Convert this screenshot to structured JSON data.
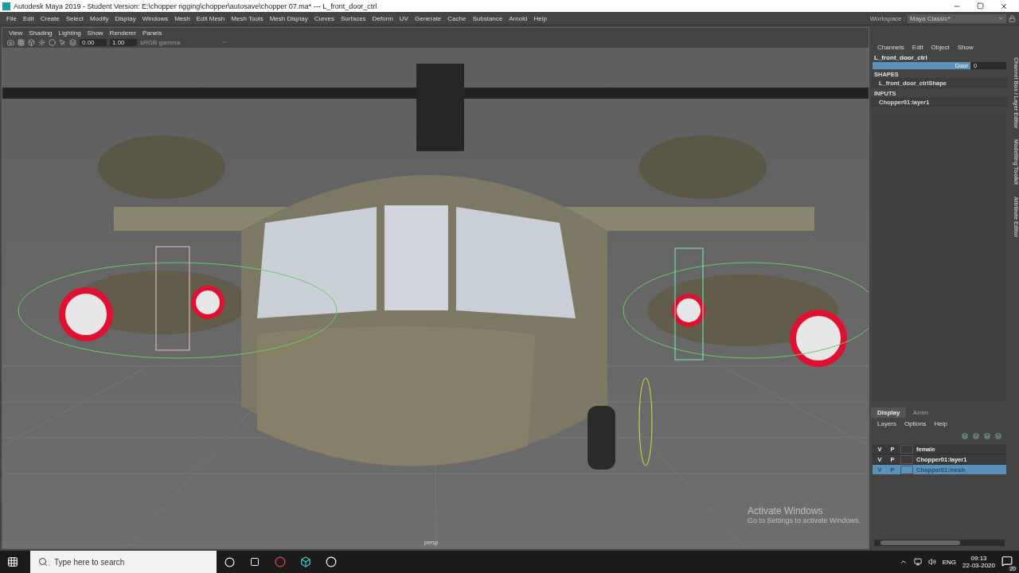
{
  "window": {
    "title": "Autodesk Maya 2019 - Student Version: E:\\chopper rigging\\chopper\\autosave\\chopper 07.ma*   ---   L_front_door_ctrl"
  },
  "menu": [
    "File",
    "Edit",
    "Create",
    "Select",
    "Modify",
    "Display",
    "Windows",
    "Mesh",
    "Edit Mesh",
    "Mesh Tools",
    "Mesh Display",
    "Curves",
    "Surfaces",
    "Deform",
    "UV",
    "Generate",
    "Cache",
    "Substance",
    "Arnold",
    "Help"
  ],
  "workspace": {
    "label": "Workspace :",
    "value": "Maya Classic*"
  },
  "viewport": {
    "menu": [
      "View",
      "Shading",
      "Lighting",
      "Show",
      "Renderer",
      "Panels"
    ],
    "exposure": "0.00",
    "gamma": "1.00",
    "color_space": "sRGB gamma",
    "camera": "persp"
  },
  "channel_box": {
    "menu": [
      "Channels",
      "Edit",
      "Object",
      "Show"
    ],
    "node": "L_front_door_ctrl",
    "attributes": [
      {
        "name": "Door",
        "value": "0",
        "selected": true
      }
    ],
    "shapes_heading": "SHAPES",
    "shapes": [
      "L_front_door_ctrlShape"
    ],
    "inputs_heading": "INPUTS",
    "inputs": [
      "Chopper01:layer1"
    ]
  },
  "side_tabs": [
    "Channel Box / Layer Editor",
    "Modelling Toolkit",
    "Attribute Editor"
  ],
  "layer_editor": {
    "tabs": [
      {
        "label": "Display",
        "selected": true
      },
      {
        "label": "Anim",
        "selected": false
      }
    ],
    "menu": [
      "Layers",
      "Options",
      "Help"
    ],
    "layers": [
      {
        "visible": "V",
        "playback": "P",
        "name": "female",
        "selected": false
      },
      {
        "visible": "V",
        "playback": "P",
        "name": "Chopper01:layer1",
        "selected": false
      },
      {
        "visible": "V",
        "playback": "P",
        "name": "Chopper01:mesh",
        "selected": true
      }
    ]
  },
  "activation": {
    "title": "Activate Windows",
    "message": "Go to Settings to activate Windows."
  },
  "taskbar": {
    "search_placeholder": "Type here to search",
    "language": "ENG",
    "time": "09:13",
    "date": "22-03-2020",
    "notifications": "20"
  }
}
